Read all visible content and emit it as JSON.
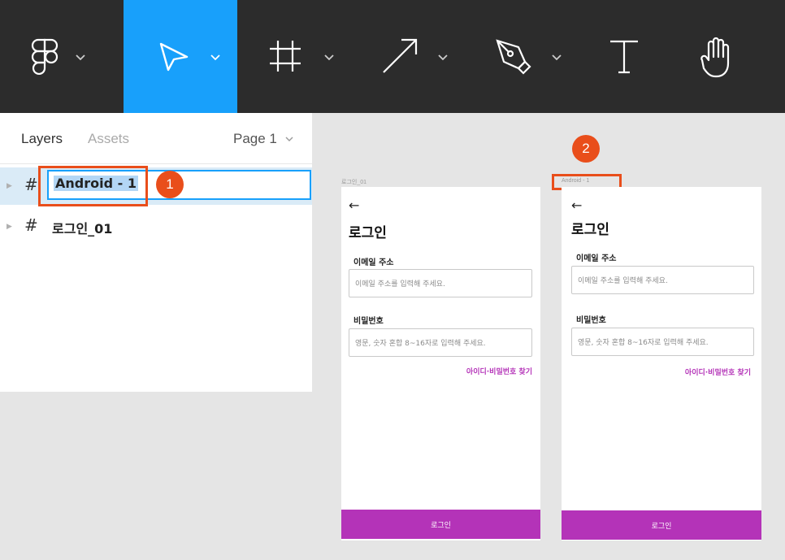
{
  "colors": {
    "toolbar": "#2c2c2c",
    "active_tool": "#18a0fb",
    "accent": "#b433b8",
    "annotation": "#e94e1b"
  },
  "toolbar": {
    "tools": [
      "figma-menu-icon",
      "move-tool-icon",
      "frame-tool-icon",
      "line-tool-icon",
      "pen-tool-icon",
      "text-tool-icon",
      "hand-tool-icon"
    ],
    "active": "move-tool-icon"
  },
  "layers_panel": {
    "tab_layers": "Layers",
    "tab_assets": "Assets",
    "page": "Page 1",
    "rows": [
      {
        "icon": "#",
        "name": "Android - 1"
      },
      {
        "icon": "#",
        "name": "로그인_01"
      }
    ]
  },
  "annotations": {
    "badge1": "1",
    "badge2": "2"
  },
  "frames": [
    {
      "label": "로그인_01",
      "back": "←",
      "title": "로그인",
      "email_label": "이메일 주소",
      "email_placeholder": "이메일 주소를 입력해 주세요.",
      "password_label": "비밀번호",
      "password_placeholder": "영문, 숫자 혼합 8~16자로 입력해 주세요.",
      "find_link": "아이디·비밀번호 찾기",
      "button": "로그인"
    },
    {
      "label": "Android - 1",
      "back": "←",
      "title": "로그인",
      "email_label": "이메일 주소",
      "email_placeholder": "이메일 주소를 입력해 주세요.",
      "password_label": "비밀번호",
      "password_placeholder": "영문, 숫자 혼합 8~16자로 입력해 주세요.",
      "find_link": "아이디·비밀번호 찾기",
      "button": "로그인"
    }
  ]
}
